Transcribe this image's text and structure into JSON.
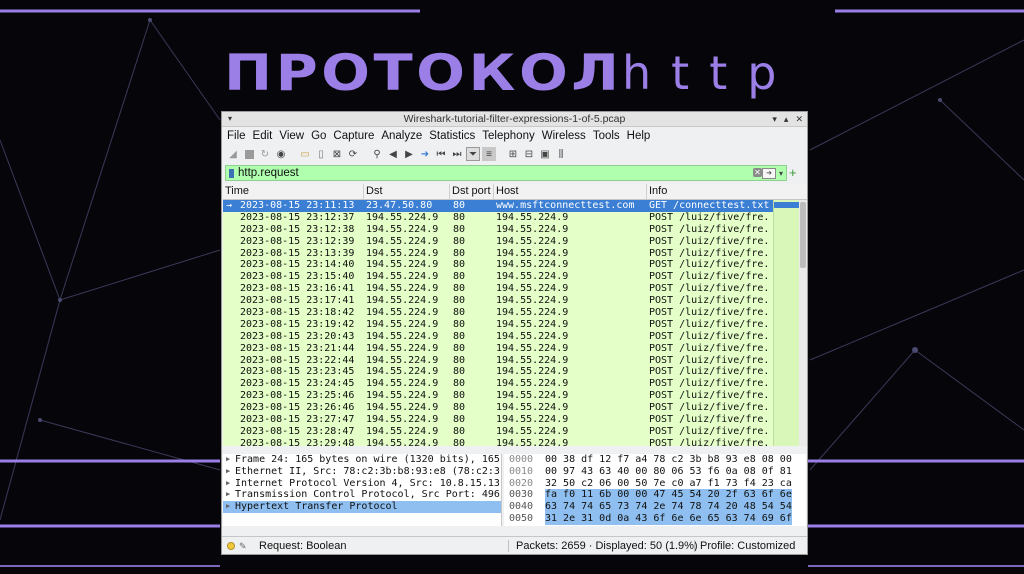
{
  "slide": {
    "title_big": "ПРОТОКОЛ",
    "title_small": "http"
  },
  "window": {
    "title": "Wireshark-tutorial-filter-expressions-1-of-5.pcap"
  },
  "menu": [
    "File",
    "Edit",
    "View",
    "Go",
    "Capture",
    "Analyze",
    "Statistics",
    "Telephony",
    "Wireless",
    "Tools",
    "Help"
  ],
  "filter": {
    "value": "http.request"
  },
  "columns": {
    "time": "Time",
    "dst": "Dst",
    "dst_port": "Dst port",
    "host": "Host",
    "info": "Info"
  },
  "packets": [
    {
      "time": "2023-08-15 23:11:13",
      "dst": "23.47.50.80",
      "port": "80",
      "host": "www.msftconnecttest.com",
      "info": "GET /connecttest.txt"
    },
    {
      "time": "2023-08-15 23:12:37",
      "dst": "194.55.224.9",
      "port": "80",
      "host": "194.55.224.9",
      "info": "POST /luiz/five/fre."
    },
    {
      "time": "2023-08-15 23:12:38",
      "dst": "194.55.224.9",
      "port": "80",
      "host": "194.55.224.9",
      "info": "POST /luiz/five/fre."
    },
    {
      "time": "2023-08-15 23:12:39",
      "dst": "194.55.224.9",
      "port": "80",
      "host": "194.55.224.9",
      "info": "POST /luiz/five/fre."
    },
    {
      "time": "2023-08-15 23:13:39",
      "dst": "194.55.224.9",
      "port": "80",
      "host": "194.55.224.9",
      "info": "POST /luiz/five/fre."
    },
    {
      "time": "2023-08-15 23:14:40",
      "dst": "194.55.224.9",
      "port": "80",
      "host": "194.55.224.9",
      "info": "POST /luiz/five/fre."
    },
    {
      "time": "2023-08-15 23:15:40",
      "dst": "194.55.224.9",
      "port": "80",
      "host": "194.55.224.9",
      "info": "POST /luiz/five/fre."
    },
    {
      "time": "2023-08-15 23:16:41",
      "dst": "194.55.224.9",
      "port": "80",
      "host": "194.55.224.9",
      "info": "POST /luiz/five/fre."
    },
    {
      "time": "2023-08-15 23:17:41",
      "dst": "194.55.224.9",
      "port": "80",
      "host": "194.55.224.9",
      "info": "POST /luiz/five/fre."
    },
    {
      "time": "2023-08-15 23:18:42",
      "dst": "194.55.224.9",
      "port": "80",
      "host": "194.55.224.9",
      "info": "POST /luiz/five/fre."
    },
    {
      "time": "2023-08-15 23:19:42",
      "dst": "194.55.224.9",
      "port": "80",
      "host": "194.55.224.9",
      "info": "POST /luiz/five/fre."
    },
    {
      "time": "2023-08-15 23:20:43",
      "dst": "194.55.224.9",
      "port": "80",
      "host": "194.55.224.9",
      "info": "POST /luiz/five/fre."
    },
    {
      "time": "2023-08-15 23:21:44",
      "dst": "194.55.224.9",
      "port": "80",
      "host": "194.55.224.9",
      "info": "POST /luiz/five/fre."
    },
    {
      "time": "2023-08-15 23:22:44",
      "dst": "194.55.224.9",
      "port": "80",
      "host": "194.55.224.9",
      "info": "POST /luiz/five/fre."
    },
    {
      "time": "2023-08-15 23:23:45",
      "dst": "194.55.224.9",
      "port": "80",
      "host": "194.55.224.9",
      "info": "POST /luiz/five/fre."
    },
    {
      "time": "2023-08-15 23:24:45",
      "dst": "194.55.224.9",
      "port": "80",
      "host": "194.55.224.9",
      "info": "POST /luiz/five/fre."
    },
    {
      "time": "2023-08-15 23:25:46",
      "dst": "194.55.224.9",
      "port": "80",
      "host": "194.55.224.9",
      "info": "POST /luiz/five/fre."
    },
    {
      "time": "2023-08-15 23:26:46",
      "dst": "194.55.224.9",
      "port": "80",
      "host": "194.55.224.9",
      "info": "POST /luiz/five/fre."
    },
    {
      "time": "2023-08-15 23:27:47",
      "dst": "194.55.224.9",
      "port": "80",
      "host": "194.55.224.9",
      "info": "POST /luiz/five/fre."
    },
    {
      "time": "2023-08-15 23:28:47",
      "dst": "194.55.224.9",
      "port": "80",
      "host": "194.55.224.9",
      "info": "POST /luiz/five/fre."
    },
    {
      "time": "2023-08-15 23:29:48",
      "dst": "194.55.224.9",
      "port": "80",
      "host": "194.55.224.9",
      "info": "POST /luiz/five/fre."
    }
  ],
  "details": [
    "Frame 24: 165 bytes on wire (1320 bits), 165",
    "Ethernet II, Src: 78:c2:3b:b8:93:e8 (78:c2:3",
    "Internet Protocol Version 4, Src: 10.8.15.13",
    "Transmission Control Protocol, Src Port: 496",
    "Hypertext Transfer Protocol"
  ],
  "bytes": [
    {
      "off": "0000",
      "hex": "00 38 df 12 f7 a4 78 c2  3b b8 93 e8 08 00"
    },
    {
      "off": "0010",
      "hex": "00 97 43 63 40 00 80 06  53 f6 0a 08 0f 81"
    },
    {
      "off": "0020",
      "hex": "32 50 c2 06 00 50 7e c0  a7 f1 73 f4 23 ca"
    },
    {
      "off": "0030",
      "hex": "fa f0 11 6b 00 00 47 45  54 20 2f 63 6f 6e"
    },
    {
      "off": "0040",
      "hex": "63 74 74 65 73 74 2e 74  78 74 20 48 54 54"
    },
    {
      "off": "0050",
      "hex": "31 2e 31 0d 0a 43 6f 6e  6e 65 63 74 69 6f"
    }
  ],
  "status": {
    "left": "Request: Boolean",
    "mid": "Packets: 2659 · Displayed: 50 (1.9%)",
    "right": "Profile: Customized"
  },
  "colors": {
    "accent_purple": "#9b7fe6",
    "filter_ok": "#afffaf",
    "row_http": "#e4ffc7",
    "selection": "#3b7fd4"
  }
}
